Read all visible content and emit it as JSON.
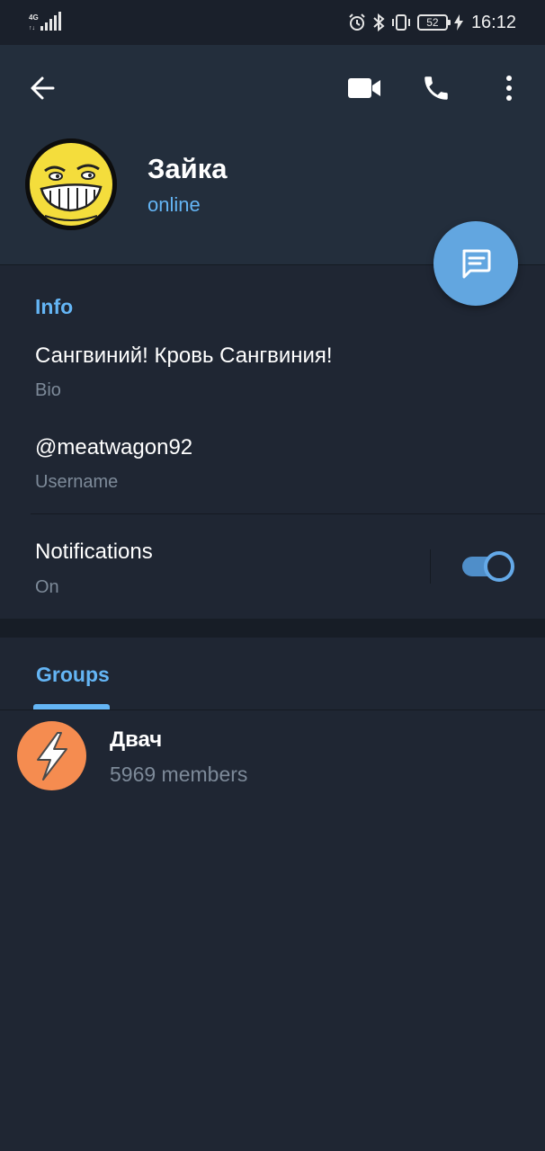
{
  "status_bar": {
    "network": "4G",
    "battery": "52",
    "time": "16:12"
  },
  "header": {
    "icons": [
      "back-arrow-icon",
      "video-call-icon",
      "phone-icon",
      "more-vert-icon"
    ],
    "profile_name": "Зайка",
    "profile_status": "online"
  },
  "info": {
    "title": "Info",
    "bio_value": "Сангвиний! Кровь Сангвиния!",
    "bio_label": "Bio",
    "username_value": "@meatwagon92",
    "username_label": "Username",
    "notifications_value": "Notifications",
    "notifications_label": "On",
    "notifications_enabled": true
  },
  "groups": {
    "title": "Groups",
    "items": [
      {
        "name": "Двач",
        "members": "5969 members"
      }
    ]
  },
  "colors": {
    "accent": "#64b5f5",
    "background": "#1f2633",
    "header_bg": "#232e3c",
    "fab": "#62a6e0",
    "group_avatar": "#f58c50"
  }
}
